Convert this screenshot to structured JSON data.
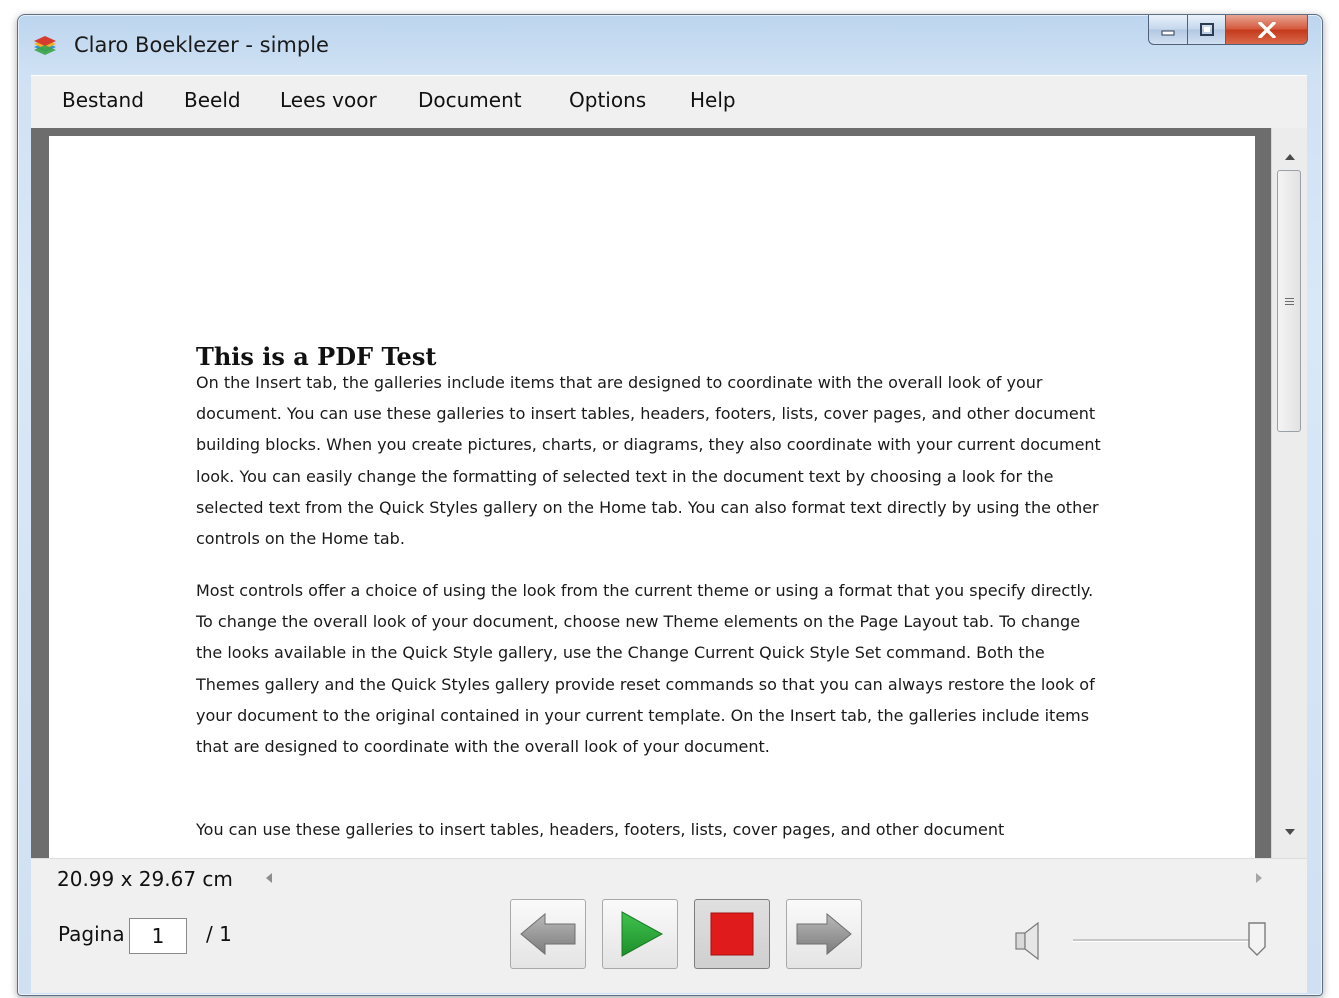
{
  "window": {
    "title": "Claro Boeklezer - simple",
    "icon": "stacked-books-icon"
  },
  "caption_buttons": {
    "minimize_icon": "minimize-icon",
    "maximize_icon": "maximize-icon",
    "close_icon": "close-icon"
  },
  "menu": {
    "items": [
      {
        "label": "Bestand"
      },
      {
        "label": "Beeld"
      },
      {
        "label": "Lees voor"
      },
      {
        "label": "Document"
      },
      {
        "label": "Options"
      },
      {
        "label": "Help"
      }
    ]
  },
  "document": {
    "title": "This is a PDF Test",
    "paragraphs": [
      "On the Insert tab, the galleries include items that are designed to coordinate with the overall look of your document. You can use these galleries to insert tables, headers, footers, lists, cover pages, and other document building blocks. When you create pictures, charts, or diagrams, they also coordinate with your current document look. You can easily change the formatting of selected text in the document text by choosing a look for the selected text from the Quick Styles gallery on the Home tab. You can also format text directly by using the other controls on the Home tab.",
      "Most controls offer a choice of using the look from the current theme or using a format that you specify directly. To change the overall look of your document, choose new Theme elements on the Page Layout tab. To change the looks available in the Quick Style gallery, use the Change Current Quick Style Set command. Both the Themes gallery and the Quick Styles gallery provide reset commands so that you can always restore the look of your document to the original contained in your current template. On the Insert tab, the galleries include items that are designed to coordinate with the overall look of your document.",
      "You can use these galleries to insert tables, headers, footers, lists, cover pages, and other document"
    ]
  },
  "statusbar": {
    "page_size": "20.99 x 29.67 cm"
  },
  "pager": {
    "label": "Pagina",
    "current": "1",
    "total": "/ 1"
  },
  "transport": {
    "previous_icon": "previous-arrow-icon",
    "play_icon": "play-icon",
    "stop_icon": "stop-icon",
    "next_icon": "next-arrow-icon",
    "play_color": "#2aa83a",
    "stop_color": "#e01b1b"
  },
  "volume": {
    "icon": "speaker-icon",
    "level": 1.0
  }
}
